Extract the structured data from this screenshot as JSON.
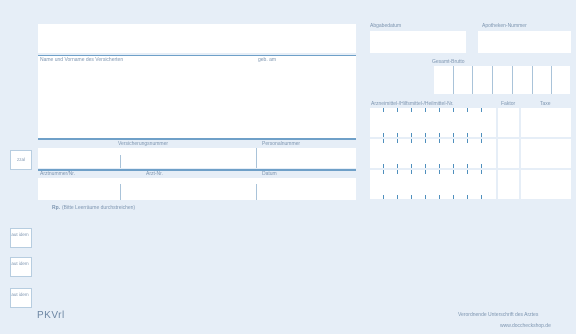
{
  "form": {
    "insured_name_label": "Name und Vorname des Versicherten",
    "dob_label": "geb. am",
    "insurance_number_label": "Versicherungsnummer",
    "personnel_number_label": "Personalnummer",
    "doctor_number_label": "Arztnummer/Nr.",
    "physician_number_label": "Arzt-Nr.",
    "date_label": "Datum",
    "rx_label": "Rp.",
    "rx_hint": "(Bitte Leerräume durchstreichen)",
    "delivery_date_label": "Abgabedatum",
    "pharmacy_number_label": "Apotheken-Nummer",
    "total_gross_label": "Gesamt-Brutto",
    "pzn_label": "Arzneimittel-/Hilfsmittel-/Heilmittel-Nr.",
    "factor_label": "Faktor",
    "fee_label": "Taxe",
    "side_label_1": "zzal",
    "side_label_2": "aut idem",
    "side_label_3": "aut idem",
    "side_label_4": "aut idem",
    "logo": "PKVrl",
    "signature_label": "Verordnende Unterschrift des Arztes",
    "footer_url": "www.doccheckshop.de"
  }
}
